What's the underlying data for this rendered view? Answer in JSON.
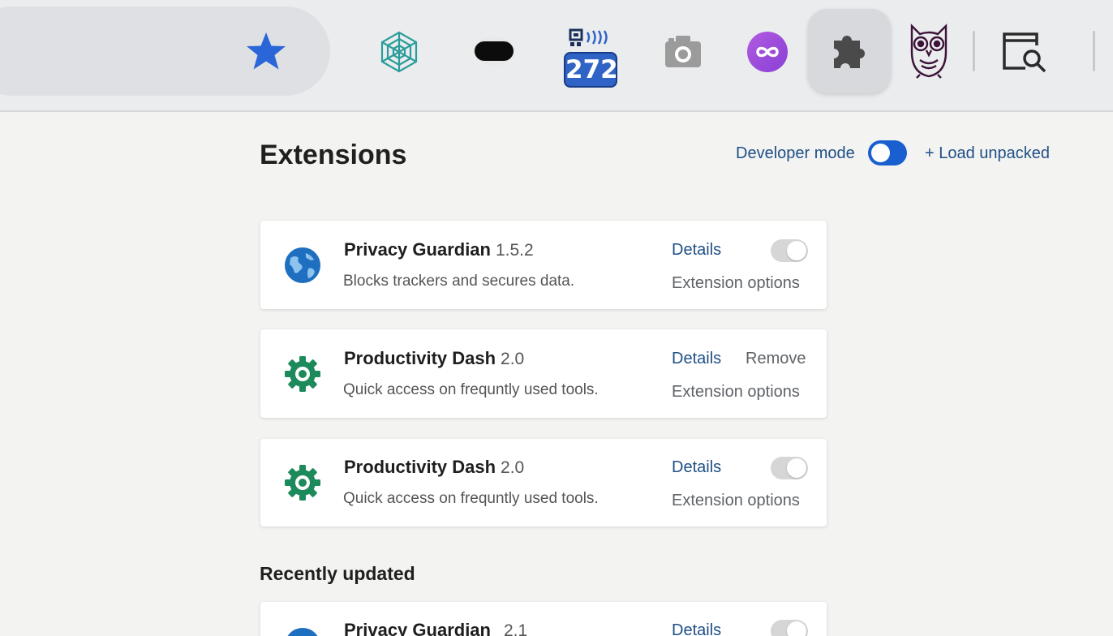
{
  "toolbar": {
    "icons": [
      "bookmark-star-icon",
      "web-icon",
      "vr-headset-icon",
      "broadcast-counter-icon",
      "camera-icon",
      "infinity-icon",
      "extensions-puzzle-icon",
      "owl-icon",
      "search-window-icon"
    ],
    "badge_count": "272",
    "accent_color": "#2f63c6"
  },
  "header": {
    "title": "Extensions",
    "developer_mode_label": "Developer mode",
    "developer_mode_on": true,
    "load_unpacked_label": "+ Load unpacked"
  },
  "extensions": [
    {
      "name": "Privacy Guardian",
      "version": "1.5.2",
      "description": "Blocks trackers and secures data.",
      "details_label": "Details",
      "options_label": "Extension options",
      "icon": "globe-icon",
      "enabled": false
    },
    {
      "name": "Productivity Dash",
      "version": "2.0",
      "description": "Quick access on frequntly used tools.",
      "details_label": "Details",
      "remove_label": "Remove",
      "options_label": "Extension options",
      "icon": "gear-icon"
    },
    {
      "name": "Productivity Dash",
      "version": "2.0",
      "description": "Quick access on frequntly used tools.",
      "details_label": "Details",
      "options_label": "Extension options",
      "icon": "gear-icon",
      "enabled": false
    }
  ],
  "recently_updated": {
    "title": "Recently updated",
    "items": [
      {
        "name": "Privacy Guardian",
        "version": "2.1",
        "details_label": "Details",
        "icon": "globe-icon",
        "enabled": false
      }
    ]
  }
}
